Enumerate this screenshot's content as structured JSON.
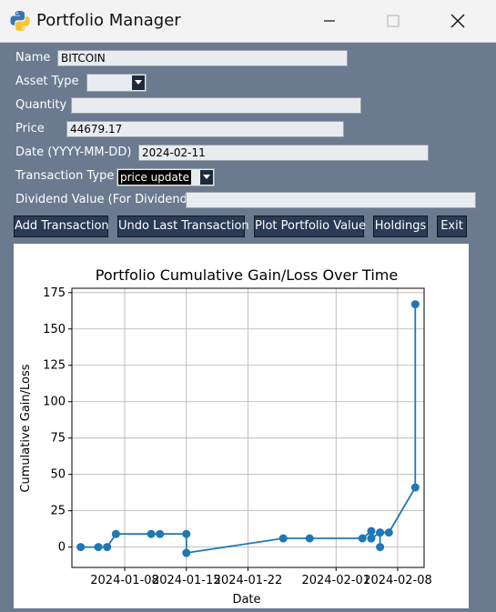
{
  "window": {
    "title": "Portfolio Manager"
  },
  "form": {
    "name_label": "Name",
    "name_value": "BITCOIN",
    "asset_type_label": "Asset Type",
    "asset_type_value": "",
    "quantity_label": "Quantity",
    "quantity_value": "",
    "price_label": "Price",
    "price_value": "44679.17",
    "date_label": "Date (YYYY-MM-DD)",
    "date_value": "2024-02-11",
    "transaction_type_label": "Transaction Type",
    "transaction_type_value": "price update",
    "dividend_label": "Dividend Value (For Dividends)",
    "dividend_value": ""
  },
  "buttons": {
    "add": "Add Transaction",
    "undo": "Undo Last Transaction",
    "plot": "Plot Portfolio Value",
    "holdings": "Holdings",
    "exit": "Exit"
  },
  "colors": {
    "line": "#1f77b4",
    "background": "#6b7a8f",
    "button": "#2b3a55"
  },
  "chart_data": {
    "type": "line",
    "title": "Portfolio Cumulative Gain/Loss Over Time",
    "xlabel": "Date",
    "ylabel": "Cumulative Gain/Loss",
    "grid": true,
    "ylim": [
      -14,
      178
    ],
    "xlim": [
      "2024-01-02",
      "2024-02-11"
    ],
    "x_ticks": [
      "2024-01-08",
      "2024-01-15",
      "2024-01-22",
      "2024-02-01",
      "2024-02-08"
    ],
    "y_ticks": [
      0,
      25,
      50,
      75,
      100,
      125,
      150,
      175
    ],
    "series": [
      {
        "x": [
          "2024-01-03",
          "2024-01-05",
          "2024-01-06",
          "2024-01-07",
          "2024-01-11",
          "2024-01-12",
          "2024-01-15",
          "2024-01-15",
          "2024-01-26",
          "2024-01-29",
          "2024-02-04",
          "2024-02-05",
          "2024-02-05",
          "2024-02-05",
          "2024-02-06",
          "2024-02-06",
          "2024-02-06",
          "2024-02-07",
          "2024-02-10",
          "2024-02-10"
        ],
        "y": [
          0,
          0,
          0,
          9,
          9,
          9,
          9,
          -4,
          6,
          6,
          6,
          11,
          6,
          6,
          10,
          0,
          10,
          10,
          41,
          167
        ]
      }
    ]
  }
}
